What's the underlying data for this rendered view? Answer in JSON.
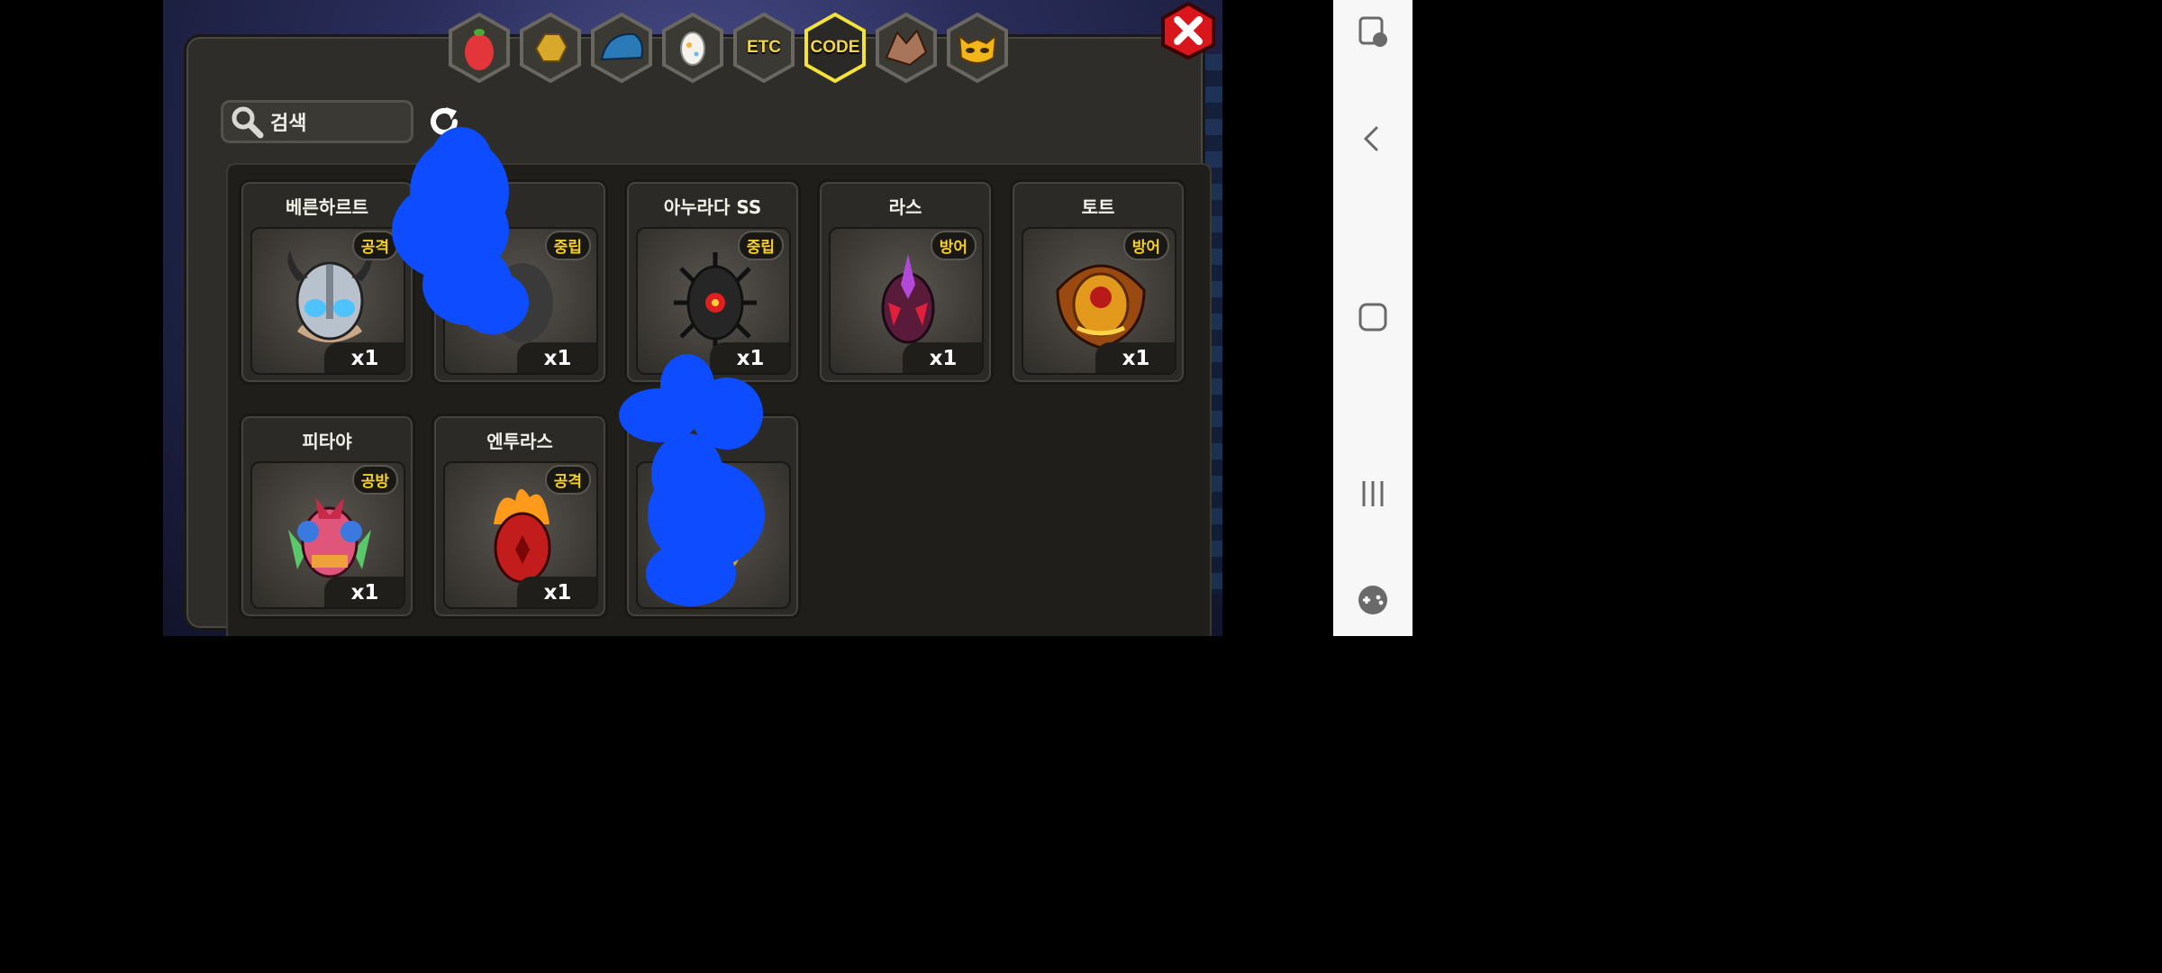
{
  "search": {
    "value": "검색",
    "icon": "search-icon"
  },
  "tabs": [
    {
      "id": "fruit",
      "icon": "pear-icon",
      "label": ""
    },
    {
      "id": "gold",
      "icon": "gold-nugget-icon",
      "label": ""
    },
    {
      "id": "scale",
      "icon": "dragon-scale-icon",
      "label": ""
    },
    {
      "id": "egg",
      "icon": "egg-icon",
      "label": ""
    },
    {
      "id": "etc",
      "icon": "",
      "label": "ETC"
    },
    {
      "id": "code",
      "icon": "",
      "label": "CODE",
      "selected": true
    },
    {
      "id": "dragon",
      "icon": "dragon-head-icon",
      "label": ""
    },
    {
      "id": "mask",
      "icon": "cat-mask-icon",
      "label": ""
    }
  ],
  "items": [
    {
      "name": "베른하르트",
      "badge": "공격",
      "qty": "x1",
      "color": "#b8c2cc"
    },
    {
      "name": "",
      "badge": "중립",
      "qty": "x1",
      "color": "#3a3a3a",
      "note": "partly hidden by blue scribble"
    },
    {
      "name": "아누라다 SS",
      "badge": "중립",
      "qty": "x1",
      "color": "#2a2a2a"
    },
    {
      "name": "라스",
      "badge": "방어",
      "qty": "x1",
      "color": "#8a1d3a"
    },
    {
      "name": "토트",
      "badge": "방어",
      "qty": "x1",
      "color": "#c07a1a"
    },
    {
      "name": "피타야",
      "badge": "공방",
      "qty": "x1",
      "color": "#e0567a"
    },
    {
      "name": "엔투라스",
      "badge": "공격",
      "qty": "x1",
      "color": "#d02b20"
    },
    {
      "name": "",
      "badge": "",
      "qty": "",
      "color": "#caa43a"
    }
  ],
  "android_nav": {
    "icons": [
      "touch-lock-icon",
      "back-icon",
      "home-icon",
      "recents-icon",
      "game-tools-icon"
    ]
  },
  "colors": {
    "accent": "#f2d64a",
    "badge_text": "#f5cf2a",
    "scribble": "#0d4cff",
    "close": "#d8161c"
  }
}
